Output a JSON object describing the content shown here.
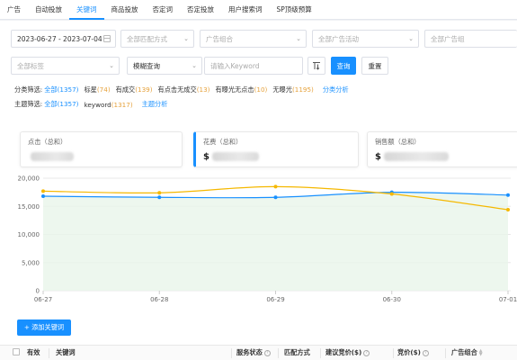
{
  "tabs": [
    {
      "label": "广告",
      "active": false
    },
    {
      "label": "自动投放",
      "active": false
    },
    {
      "label": "关键词",
      "active": true
    },
    {
      "label": "商品投放",
      "active": false
    },
    {
      "label": "否定词",
      "active": false
    },
    {
      "label": "否定投放",
      "active": false
    },
    {
      "label": "用户搜索词",
      "active": false
    },
    {
      "label": "SP顶级预算",
      "active": false
    }
  ],
  "filters": {
    "date_range": "2023-06-27 - 2023-07-04",
    "match_type_placeholder": "全部匹配方式",
    "ad_group_placeholder": "广告组合",
    "campaign_placeholder": "全部广告活动",
    "adgroup_placeholder": "全部广告组",
    "tag_placeholder": "全部标签",
    "query_mode": "模糊查询",
    "keyword_placeholder": "请输入Keyword",
    "query_button": "查询",
    "reset_button": "重置"
  },
  "category_filter": {
    "label": "分类筛选:",
    "options": [
      {
        "name": "全部",
        "count": "(1357)",
        "selected": true
      },
      {
        "name": "标星",
        "count": "(74)",
        "selected": false
      },
      {
        "name": "有成交",
        "count": "(139)",
        "selected": false
      },
      {
        "name": "有点击无成交",
        "count": "(13)",
        "selected": false
      },
      {
        "name": "有曝光无点击",
        "count": "(10)",
        "selected": false
      },
      {
        "name": "无曝光",
        "count": "(1195)",
        "selected": false
      }
    ],
    "link": "分类分析"
  },
  "topic_filter": {
    "label": "主题筛选:",
    "options": [
      {
        "name": "全部",
        "count": "(1357)",
        "selected": true
      },
      {
        "name": "keyword",
        "count": "(1317)",
        "selected": false
      }
    ],
    "link": "主题分析"
  },
  "metric_cards": [
    {
      "label": "点击（总和）",
      "currency": "",
      "active": false
    },
    {
      "label": "花费（总和）",
      "currency": "$",
      "active": true
    },
    {
      "label": "销售额（总和）",
      "currency": "$",
      "active": false
    }
  ],
  "chart_data": {
    "type": "line",
    "x": [
      "06-27",
      "06-28",
      "06-29",
      "06-30",
      "07-01"
    ],
    "ylim": [
      0,
      20000
    ],
    "yticks": [
      "0",
      "5,000",
      "10,000",
      "15,000",
      "20,000"
    ],
    "grid": true,
    "series": [
      {
        "color": "#1890ff",
        "values": [
          16800,
          16600,
          16600,
          17500,
          17000
        ],
        "area": true
      },
      {
        "color": "#f5b800",
        "values": [
          17700,
          17400,
          18500,
          17200,
          14400
        ],
        "area": false
      }
    ]
  },
  "add_keyword_button": "+ 添加关键词",
  "table_headers": [
    {
      "label": "有效",
      "help": false,
      "sort": false
    },
    {
      "label": "关键词",
      "help": false,
      "sort": false
    },
    {
      "label": "服务状态",
      "help": true,
      "sort": false
    },
    {
      "label": "匹配方式",
      "help": false,
      "sort": false
    },
    {
      "label": "建议竞价($)",
      "help": true,
      "sort": false
    },
    {
      "label": "竞价($)",
      "help": true,
      "sort": false
    },
    {
      "label": "广告组合",
      "help": false,
      "sort": true
    }
  ],
  "colors": {
    "accent": "#1890ff",
    "secondary_line": "#f5b800",
    "count": "#e6a23c"
  }
}
